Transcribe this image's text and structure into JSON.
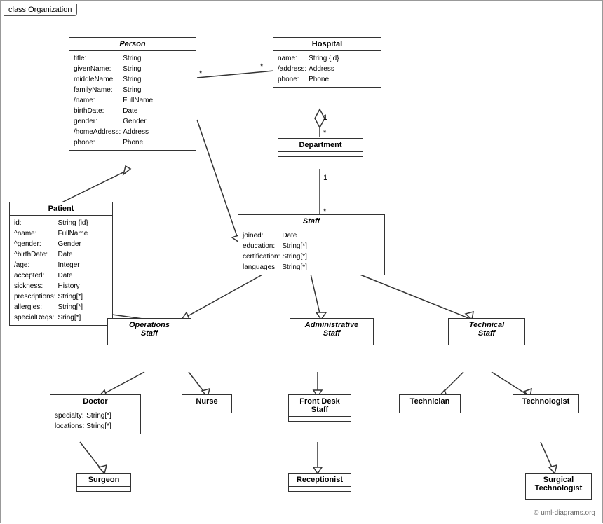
{
  "diagram": {
    "title": "class Organization",
    "classes": {
      "person": {
        "name": "Person",
        "italic": true,
        "attributes": [
          [
            "title:",
            "String"
          ],
          [
            "givenName:",
            "String"
          ],
          [
            "middleName:",
            "String"
          ],
          [
            "familyName:",
            "String"
          ],
          [
            "/name:",
            "FullName"
          ],
          [
            "birthDate:",
            "Date"
          ],
          [
            "gender:",
            "Gender"
          ],
          [
            "/homeAddress:",
            "Address"
          ],
          [
            "phone:",
            "Phone"
          ]
        ]
      },
      "hospital": {
        "name": "Hospital",
        "italic": false,
        "attributes": [
          [
            "name:",
            "String {id}"
          ],
          [
            "/address:",
            "Address"
          ],
          [
            "phone:",
            "Phone"
          ]
        ]
      },
      "department": {
        "name": "Department",
        "italic": false,
        "attributes": []
      },
      "patient": {
        "name": "Patient",
        "italic": false,
        "attributes": [
          [
            "id:",
            "String {id}"
          ],
          [
            "^name:",
            "FullName"
          ],
          [
            "^gender:",
            "Gender"
          ],
          [
            "^birthDate:",
            "Date"
          ],
          [
            "/age:",
            "Integer"
          ],
          [
            "accepted:",
            "Date"
          ],
          [
            "sickness:",
            "History"
          ],
          [
            "prescriptions:",
            "String[*]"
          ],
          [
            "allergies:",
            "String[*]"
          ],
          [
            "specialReqs:",
            "Sring[*]"
          ]
        ]
      },
      "staff": {
        "name": "Staff",
        "italic": true,
        "attributes": [
          [
            "joined:",
            "Date"
          ],
          [
            "education:",
            "String[*]"
          ],
          [
            "certification:",
            "String[*]"
          ],
          [
            "languages:",
            "String[*]"
          ]
        ]
      },
      "operations_staff": {
        "name": "Operations Staff",
        "italic": true,
        "attributes": []
      },
      "administrative_staff": {
        "name": "Administrative Staff",
        "italic": true,
        "attributes": []
      },
      "technical_staff": {
        "name": "Technical Staff",
        "italic": true,
        "attributes": []
      },
      "doctor": {
        "name": "Doctor",
        "italic": false,
        "attributes": [
          [
            "specialty:",
            "String[*]"
          ],
          [
            "locations:",
            "String[*]"
          ]
        ]
      },
      "nurse": {
        "name": "Nurse",
        "italic": false,
        "attributes": []
      },
      "front_desk_staff": {
        "name": "Front Desk Staff",
        "italic": false,
        "attributes": []
      },
      "technician": {
        "name": "Technician",
        "italic": false,
        "attributes": []
      },
      "technologist": {
        "name": "Technologist",
        "italic": false,
        "attributes": []
      },
      "surgeon": {
        "name": "Surgeon",
        "italic": false,
        "attributes": []
      },
      "receptionist": {
        "name": "Receptionist",
        "italic": false,
        "attributes": []
      },
      "surgical_technologist": {
        "name": "Surgical Technologist",
        "italic": false,
        "attributes": []
      }
    },
    "copyright": "© uml-diagrams.org"
  }
}
